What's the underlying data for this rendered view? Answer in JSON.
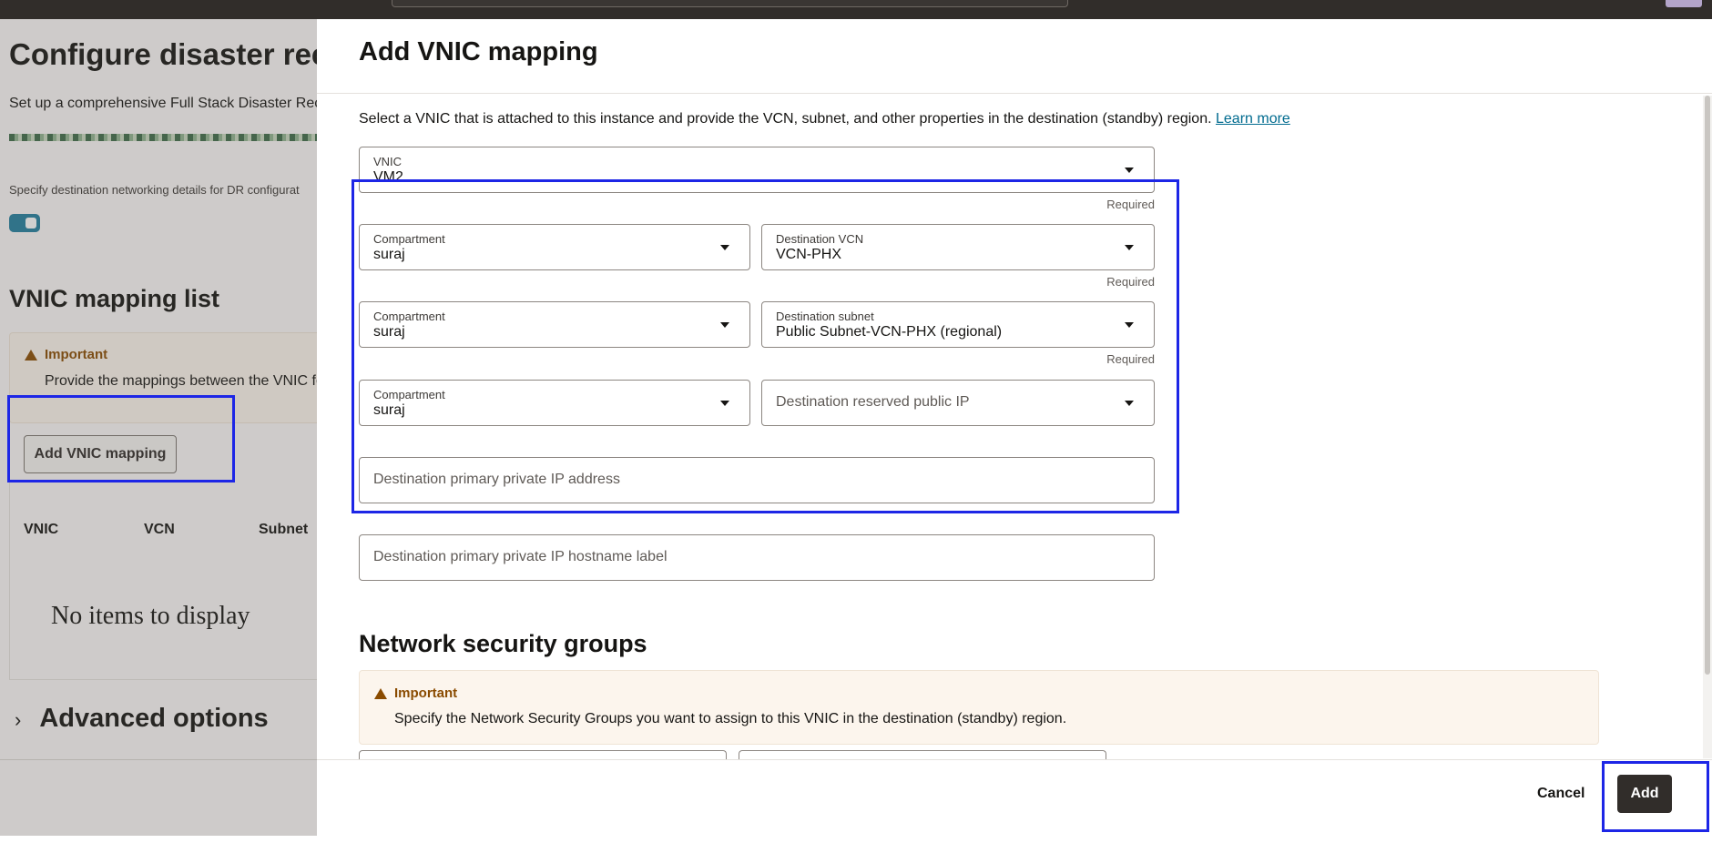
{
  "background": {
    "title": "Configure disaster reco",
    "subtitle": "Set up a comprehensive Full Stack Disaster Recov",
    "spec_text": "Specify destination networking details for DR configurat",
    "vnic_list_heading": "VNIC mapping list",
    "important_title": "Important",
    "important_text": "Provide the mappings between the VNIC for",
    "add_vnic_button": "Add VNIC mapping",
    "columns": [
      "VNIC",
      "VCN",
      "Subnet"
    ],
    "empty_text": "No items to display",
    "advanced_options": "Advanced options"
  },
  "drawer": {
    "title": "Add VNIC mapping",
    "intro": "Select a VNIC that is attached to this instance and provide the VCN, subnet, and other properties in the destination (standby) region.",
    "learn_more": "Learn more",
    "vnic": {
      "label": "VNIC",
      "value": "VM2",
      "required": "Required"
    },
    "compartment1": {
      "label": "Compartment",
      "value": "suraj"
    },
    "dest_vcn": {
      "label": "Destination VCN",
      "value": "VCN-PHX",
      "required": "Required"
    },
    "compartment2": {
      "label": "Compartment",
      "value": "suraj"
    },
    "dest_subnet": {
      "label": "Destination subnet",
      "value": "Public Subnet-VCN-PHX (regional)",
      "required": "Required"
    },
    "compartment3": {
      "label": "Compartment",
      "value": "suraj"
    },
    "dest_public_ip": {
      "placeholder": "Destination reserved public IP"
    },
    "dest_private_ip": {
      "placeholder": "Destination primary private IP address"
    },
    "dest_hostname": {
      "placeholder": "Destination primary private IP hostname label"
    },
    "nsg_heading": "Network security groups",
    "nsg_important_title": "Important",
    "nsg_important_text": "Specify the Network Security Groups you want to assign to this VNIC in the destination (standby) region.",
    "cancel": "Cancel",
    "add": "Add"
  }
}
